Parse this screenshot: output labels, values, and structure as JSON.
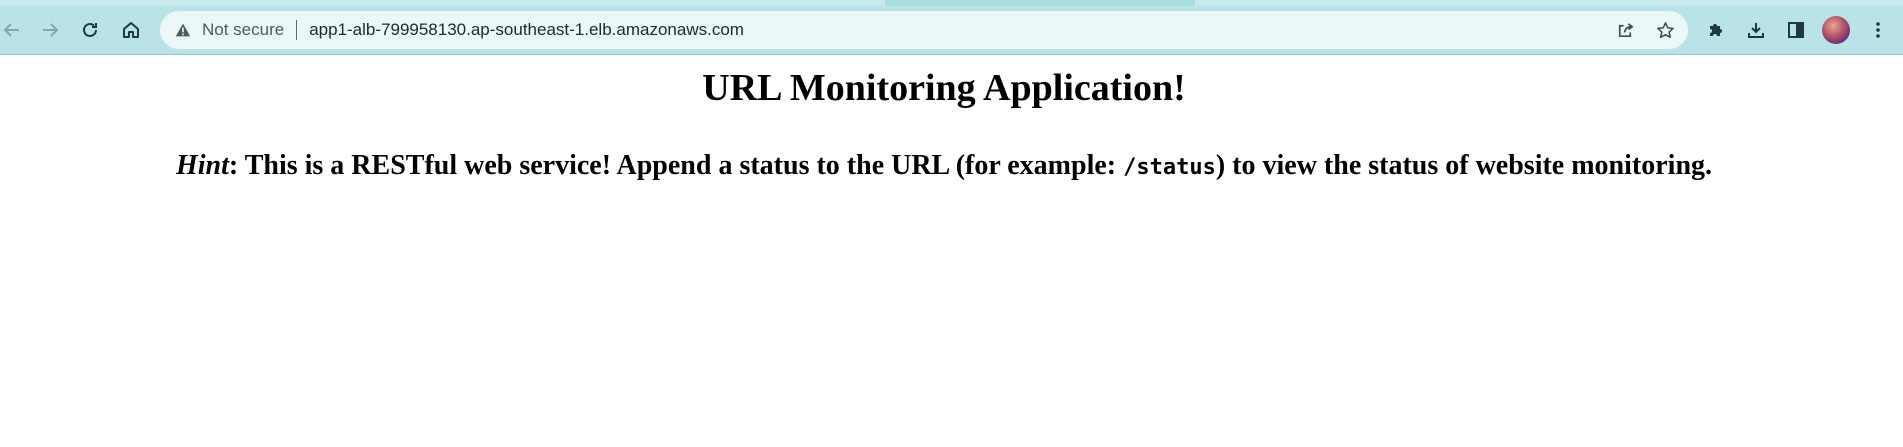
{
  "browser": {
    "security_label": "Not secure",
    "url": "app1-alb-799958130.ap-southeast-1.elb.amazonaws.com",
    "icons": {
      "back": "arrow-left-icon",
      "forward": "arrow-right-icon",
      "reload": "reload-icon",
      "home": "home-icon",
      "warning": "warning-triangle-icon",
      "share": "share-icon",
      "bookmark": "star-icon",
      "extensions": "puzzle-icon",
      "downloads": "download-icon",
      "side_panel": "side-panel-icon",
      "menu": "kebab-menu-icon"
    },
    "colors": {
      "chrome_bg": "#b9e3e7",
      "omnibox_bg": "#ecf7f8"
    }
  },
  "page": {
    "title": "URL Monitoring Application!",
    "hint_label": "Hint",
    "hint_text_before": ": This is a RESTful web service! Append a status to the URL (for example: ",
    "hint_code": "/status",
    "hint_text_after": ") to view the status of website monitoring."
  }
}
